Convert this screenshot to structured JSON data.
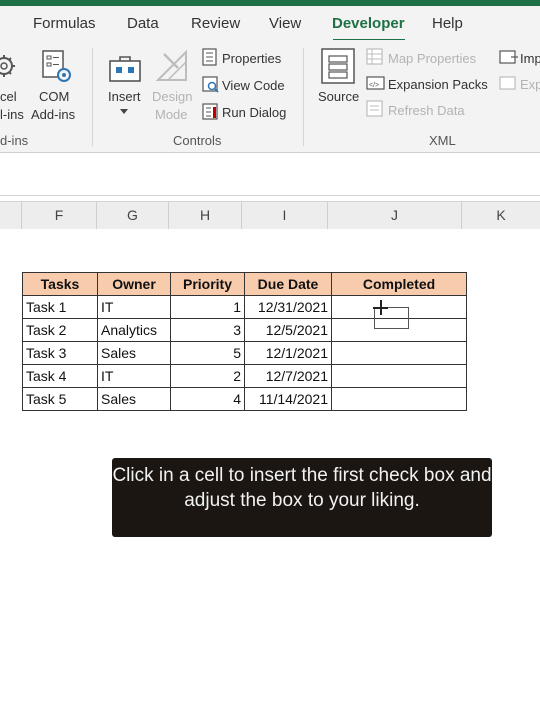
{
  "ribbon_tabs": [
    "Formulas",
    "Data",
    "Review",
    "View",
    "Developer",
    "Help"
  ],
  "active_tab": "Developer",
  "ribbon": {
    "addins_group": {
      "excel_addins_line1": "cel",
      "excel_addins_line2": "l-ins",
      "com_addins_line1": "COM",
      "com_addins_line2": "Add-ins",
      "label": "d-ins"
    },
    "controls_group": {
      "insert": "Insert",
      "design_mode_line1": "Design",
      "design_mode_line2": "Mode",
      "properties": "Properties",
      "view_code": "View Code",
      "run_dialog": "Run Dialog",
      "label": "Controls"
    },
    "xml_group": {
      "source": "Source",
      "map_properties": "Map Properties",
      "expansion_packs": "Expansion Packs",
      "refresh_data": "Refresh Data",
      "import": "Imp",
      "export": "Exp",
      "label": "XML"
    }
  },
  "column_headers": [
    "F",
    "G",
    "H",
    "I",
    "J",
    "K"
  ],
  "table": {
    "headers": [
      "Tasks",
      "Owner",
      "Priority",
      "Due Date",
      "Completed"
    ],
    "rows": [
      [
        "Task 1",
        "IT",
        "1",
        "12/31/2021",
        ""
      ],
      [
        "Task 2",
        "Analytics",
        "3",
        "12/5/2021",
        ""
      ],
      [
        "Task 3",
        "Sales",
        "5",
        "12/1/2021",
        ""
      ],
      [
        "Task 4",
        "IT",
        "2",
        "12/7/2021",
        ""
      ],
      [
        "Task 5",
        "Sales",
        "4",
        "11/14/2021",
        ""
      ]
    ]
  },
  "caption": "Click in a cell to insert the first check box and adjust the box to your liking.",
  "colors": {
    "accent": "#1e7145",
    "header_fill": "#f8cbad",
    "caption_bg": "#1b1612"
  }
}
